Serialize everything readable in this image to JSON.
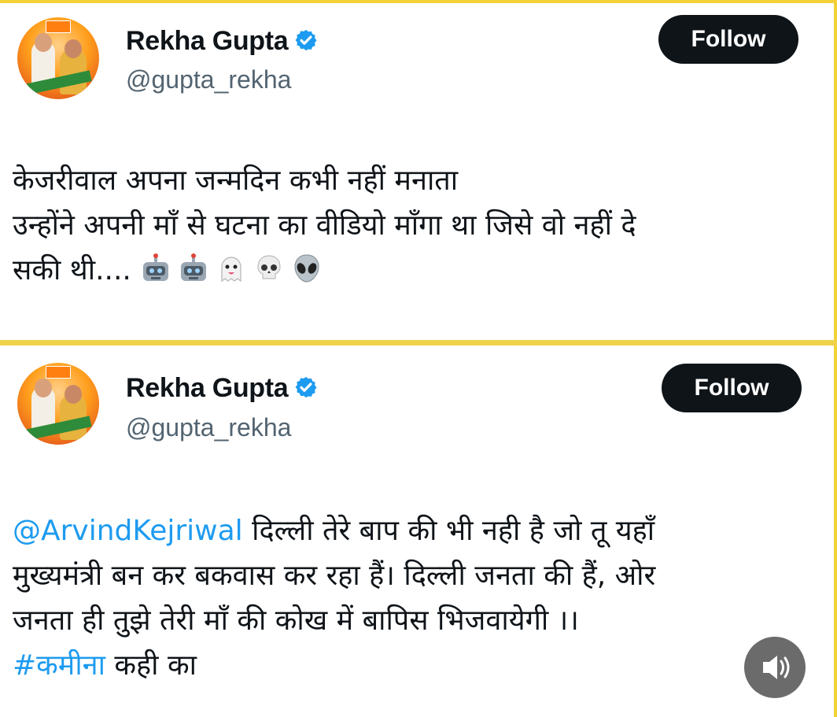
{
  "tweets": [
    {
      "name": "Rekha Gupta",
      "handle": "@gupta_rekha",
      "follow_label": "Follow",
      "lines": [
        "केजरीवाल अपना जन्मदिन कभी नहीं मनाता",
        "उन्होंने अपनी माँ से घटना का वीडियो माँगा था जिसे वो नहीं दे",
        "सकी थी...."
      ],
      "emojis": [
        "robot-emoji",
        "robot-emoji",
        "ghost-emoji",
        "skull-emoji",
        "alien-emoji"
      ]
    },
    {
      "name": "Rekha Gupta",
      "handle": "@gupta_rekha",
      "follow_label": "Follow",
      "mention": "@ArvindKejriwal",
      "line1_rest": " दिल्ली तेरे बाप की भी नही है जो तू यहाँ",
      "line2": "मुख्यमंत्री बन कर बकवास कर रहा हैं। दिल्ली जनता की हैं, ओर",
      "line3": "जनता ही तुझे तेरी माँ की कोख में बापिस भिजवायेगी ।।",
      "hashtag": "#कमीना",
      "line4_rest": " कही का"
    }
  ],
  "colors": {
    "accent_link": "#1d9bf0",
    "verified": "#1d9bf0",
    "follow_bg": "#0f1419",
    "frame": "#f3d238"
  },
  "icons": {
    "verified": "verified-badge-icon",
    "speaker": "speaker-icon"
  }
}
